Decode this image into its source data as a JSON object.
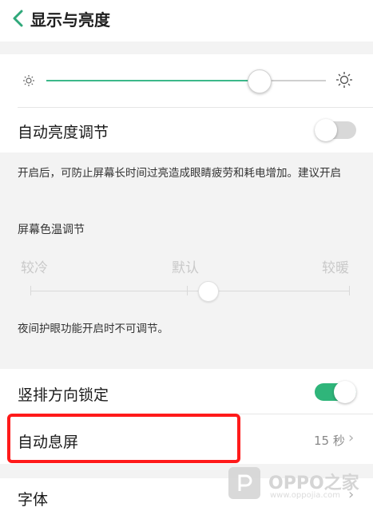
{
  "header": {
    "title": "显示与亮度",
    "back_icon": "chevron-left-icon"
  },
  "brightness": {
    "level_fraction": 0.76,
    "min_icon": "sun-small-icon",
    "max_icon": "sun-large-icon",
    "accent_color": "#3cb88a"
  },
  "auto_brightness": {
    "label": "自动亮度调节",
    "enabled": false
  },
  "auto_brightness_note": "开启后，可防止屏幕长时间过亮造成眼睛疲劳和耗电增加。建议开启",
  "color_temperature": {
    "title": "屏幕色温调节",
    "labels": [
      "较冷",
      "默认",
      "较暖"
    ],
    "note": "夜间护眼功能开启时不可调节。"
  },
  "portrait_lock": {
    "label": "竖排方向锁定",
    "enabled": true,
    "color": "#2fb57a"
  },
  "auto_sleep": {
    "label": "自动息屏",
    "value": "15 秒",
    "highlight_color": "#ff1a1a"
  },
  "font": {
    "label": "字体"
  },
  "watermark": {
    "brand": "OPPO之家",
    "url": "www.oppojia.com"
  }
}
